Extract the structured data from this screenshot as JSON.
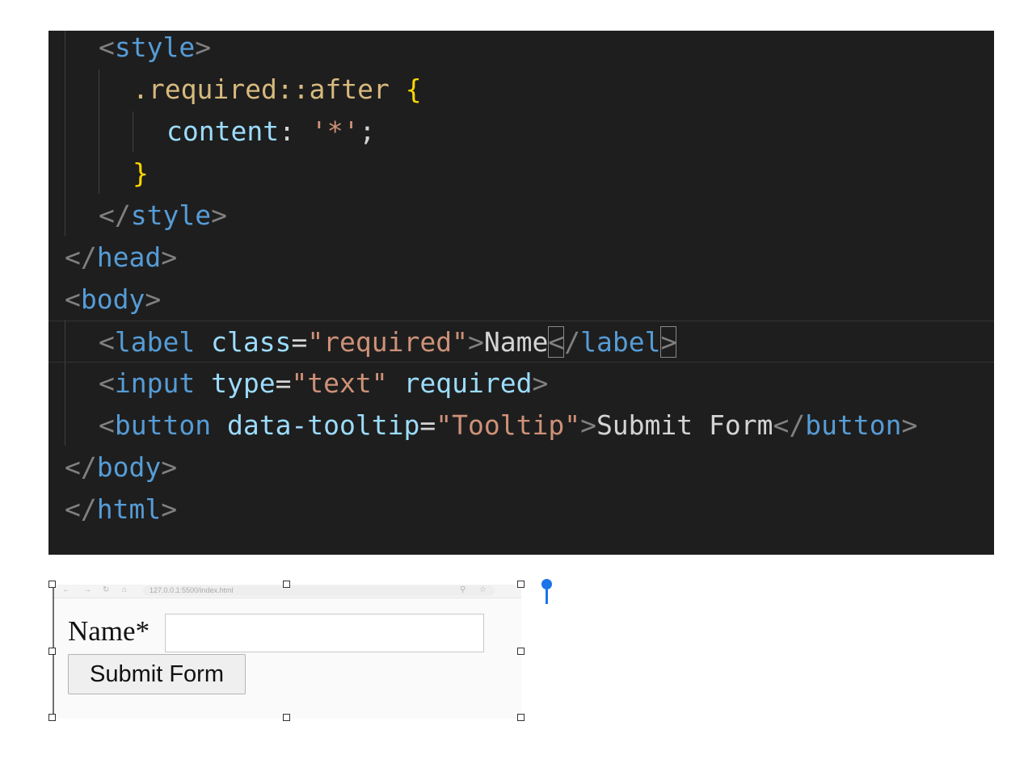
{
  "editor": {
    "lines": [
      {
        "p1": "<",
        "tag": "style",
        "p2": ">"
      },
      {
        "selector": ".required::after",
        "space": " ",
        "brace": "{"
      },
      {
        "prop": "content",
        "colon": ": ",
        "value": "'*'",
        "semi": ";"
      },
      {
        "brace": "}"
      },
      {
        "p1": "</",
        "tag": "style",
        "p2": ">"
      },
      {
        "p1": "</",
        "tag": "head",
        "p2": ">"
      },
      {
        "p1": "<",
        "tag": "body",
        "p2": ">"
      },
      {
        "p1": "<",
        "tag": "label",
        "attr": " class",
        "eq": "=",
        "value": "\"required\"",
        "p2": ">",
        "text": "Name",
        "p3": "<",
        "p4": "/",
        "tag2": "label",
        "p5": ">"
      },
      {
        "p1": "<",
        "tag": "input",
        "attr": " type",
        "eq": "=",
        "value": "\"text\"",
        "attr2": " required",
        "p2": ">"
      },
      {
        "p1": "<",
        "tag": "button",
        "attr": " data-tooltip",
        "eq": "=",
        "value": "\"Tooltip\"",
        "p2": ">",
        "text": "Submit Form",
        "p3": "</",
        "tag2": "button",
        "p4": ">"
      },
      {
        "p1": "</",
        "tag": "body",
        "p2": ">"
      },
      {
        "p1": "</",
        "tag": "html",
        "p2": ">"
      }
    ]
  },
  "preview": {
    "url": "127.0.0.1:5500/index.html",
    "label": "Name*",
    "input_value": "",
    "button_label": "Submit Form"
  },
  "colors": {
    "editor_bg": "#1e1e1e",
    "tag": "#569cd6",
    "attribute": "#9cdcfe",
    "string": "#ce9178",
    "selector": "#d7ba7d",
    "brace": "#ffd700",
    "punctuation": "#808080",
    "pin": "#1a73e8"
  }
}
